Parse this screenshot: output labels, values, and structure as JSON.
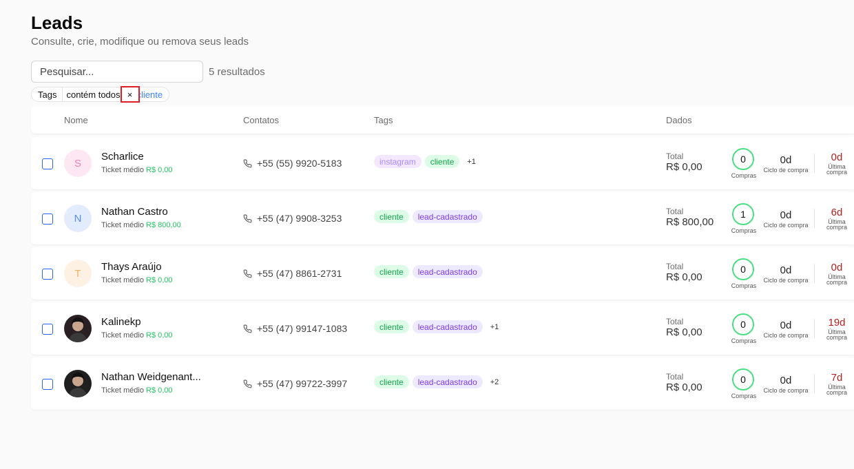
{
  "page": {
    "title": "Leads",
    "subtitle": "Consulte, crie, modifique ou remova seus leads"
  },
  "search": {
    "placeholder": "Pesquisar...",
    "value": ""
  },
  "results_label": "5 resultados",
  "filter": {
    "field": "Tags",
    "operator": "contém todos",
    "remove_glyph": "×",
    "value": "cliente"
  },
  "table": {
    "columns": {
      "name": "Nome",
      "contacts": "Contatos",
      "tags": "Tags",
      "data": "Dados"
    },
    "labels": {
      "ticket": "Ticket médio",
      "total": "Total",
      "purchases": "Compras",
      "cycle": "Ciclo de compra",
      "last1": "Última",
      "last2": "compra"
    },
    "rows": [
      {
        "initial": "S",
        "avatar_bg": "#fde7f3",
        "avatar_fg": "#ec7fb6",
        "avatar_photo": false,
        "name": "Scharlice",
        "ticket": "R$ 0,00",
        "phone": "+55 (55) 9920-5183",
        "tags": [
          {
            "label": "instagram",
            "style": "ig"
          },
          {
            "label": "cliente",
            "style": "green"
          }
        ],
        "more": "+1",
        "total": "R$ 0,00",
        "purchases": "0",
        "cycle": "0d",
        "last": "0d"
      },
      {
        "initial": "N",
        "avatar_bg": "#e3ecfd",
        "avatar_fg": "#5b8def",
        "avatar_photo": false,
        "name": "Nathan Castro",
        "ticket": "R$ 800,00",
        "phone": "+55 (47) 9908-3253",
        "tags": [
          {
            "label": "cliente",
            "style": "green"
          },
          {
            "label": "lead-cadastrado",
            "style": "purple"
          }
        ],
        "more": "",
        "total": "R$ 800,00",
        "purchases": "1",
        "cycle": "0d",
        "last": "6d"
      },
      {
        "initial": "T",
        "avatar_bg": "#fdf1e4",
        "avatar_fg": "#f0b466",
        "avatar_photo": false,
        "name": "Thays Araújo",
        "ticket": "R$ 0,00",
        "phone": "+55 (47) 8861-2731",
        "tags": [
          {
            "label": "cliente",
            "style": "green"
          },
          {
            "label": "lead-cadastrado",
            "style": "purple"
          }
        ],
        "more": "",
        "total": "R$ 0,00",
        "purchases": "0",
        "cycle": "0d",
        "last": "0d"
      },
      {
        "initial": "",
        "avatar_bg": "#2a2024",
        "avatar_fg": "#ffffff",
        "avatar_photo": true,
        "name": "Kalinekp",
        "ticket": "R$ 0,00",
        "phone": "+55 (47) 99147-1083",
        "tags": [
          {
            "label": "cliente",
            "style": "green"
          },
          {
            "label": "lead-cadastrado",
            "style": "purple"
          }
        ],
        "more": "+1",
        "total": "R$ 0,00",
        "purchases": "0",
        "cycle": "0d",
        "last": "19d"
      },
      {
        "initial": "",
        "avatar_bg": "#1f1f1f",
        "avatar_fg": "#ffffff",
        "avatar_photo": true,
        "name": "Nathan Weidgenant...",
        "ticket": "R$ 0,00",
        "phone": "+55 (47) 99722-3997",
        "tags": [
          {
            "label": "cliente",
            "style": "green"
          },
          {
            "label": "lead-cadastrado",
            "style": "purple"
          }
        ],
        "more": "+2",
        "total": "R$ 0,00",
        "purchases": "0",
        "cycle": "0d",
        "last": "7d"
      }
    ]
  },
  "icons": {
    "phone": "phone-icon",
    "remove": "close-icon"
  }
}
